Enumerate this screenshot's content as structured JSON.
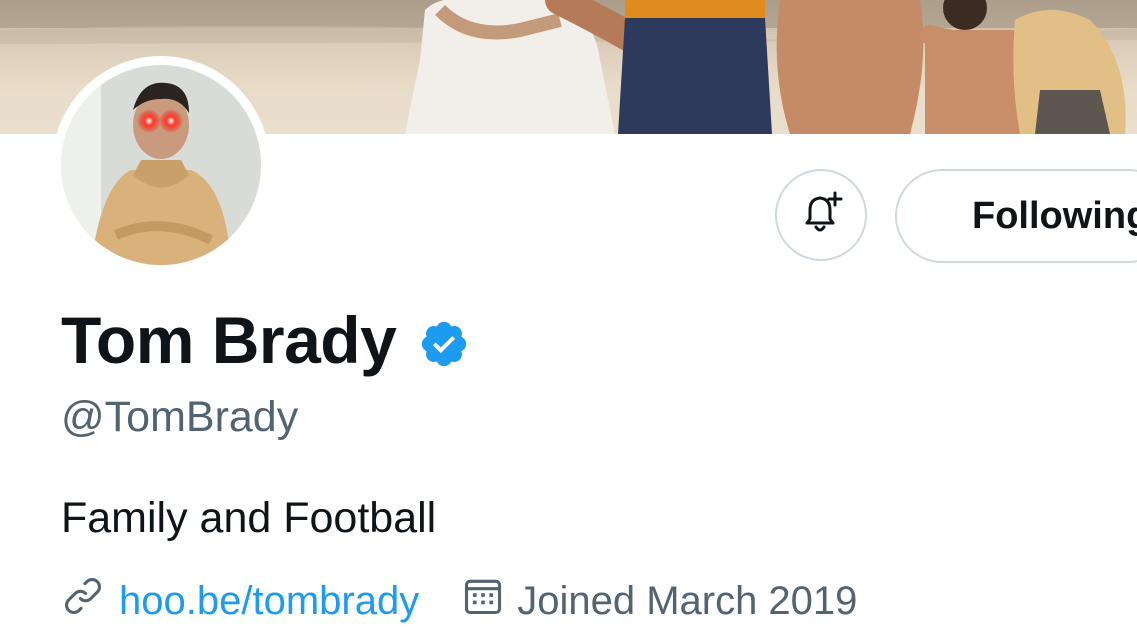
{
  "profile": {
    "display_name": "Tom Brady",
    "handle": "@TomBrady",
    "bio": "Family and Football",
    "website": "hoo.be/tombrady",
    "joined": "Joined March 2019",
    "verified": true
  },
  "actions": {
    "follow_label": "Following",
    "notifications_icon": "bell-plus-icon"
  },
  "colors": {
    "link": "#1d9bf0",
    "verified_badge": "#1d9bf0",
    "secondary_text": "#536471",
    "primary_text": "#0f1419",
    "border": "#cfd9de"
  }
}
